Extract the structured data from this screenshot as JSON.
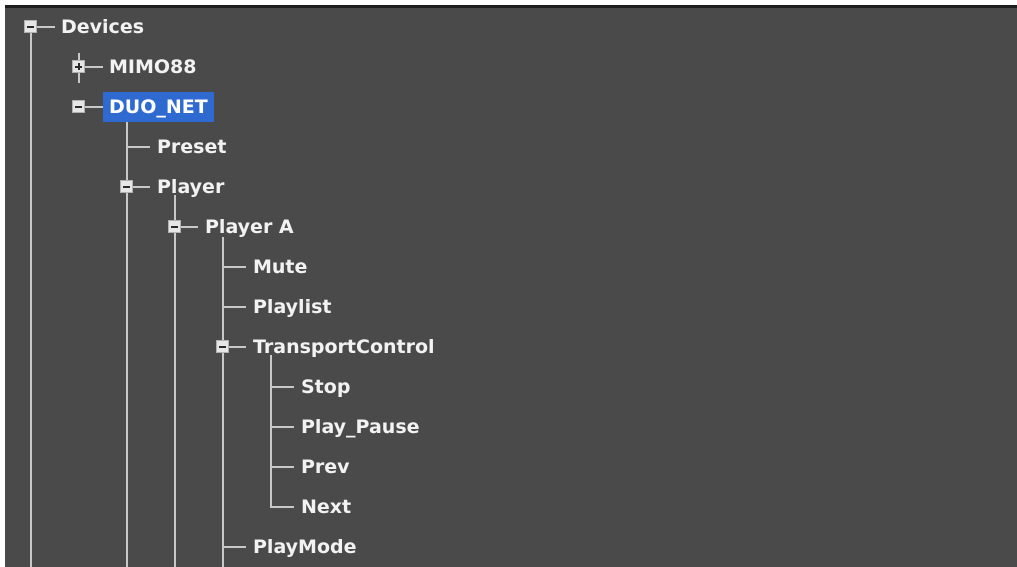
{
  "tree": {
    "root_label": "Devices",
    "mimo88": "MIMO88",
    "duo_net": "DUO_NET",
    "preset": "Preset",
    "player": "Player",
    "player_a": "Player A",
    "mute": "Mute",
    "playlist": "Playlist",
    "transport_control": "TransportControl",
    "stop": "Stop",
    "play_pause": "Play_Pause",
    "prev": "Prev",
    "next": "Next",
    "playmode": "PlayMode"
  },
  "selected_node": "DUO_NET",
  "icons": {
    "collapse": "collapse-minus-icon",
    "expand": "expand-plus-icon"
  },
  "colors": {
    "panel_background": "#4a4a4a",
    "selection": "#2f6ad0",
    "text": "#f2f2f2",
    "tree_line": "#c8c8c8"
  }
}
